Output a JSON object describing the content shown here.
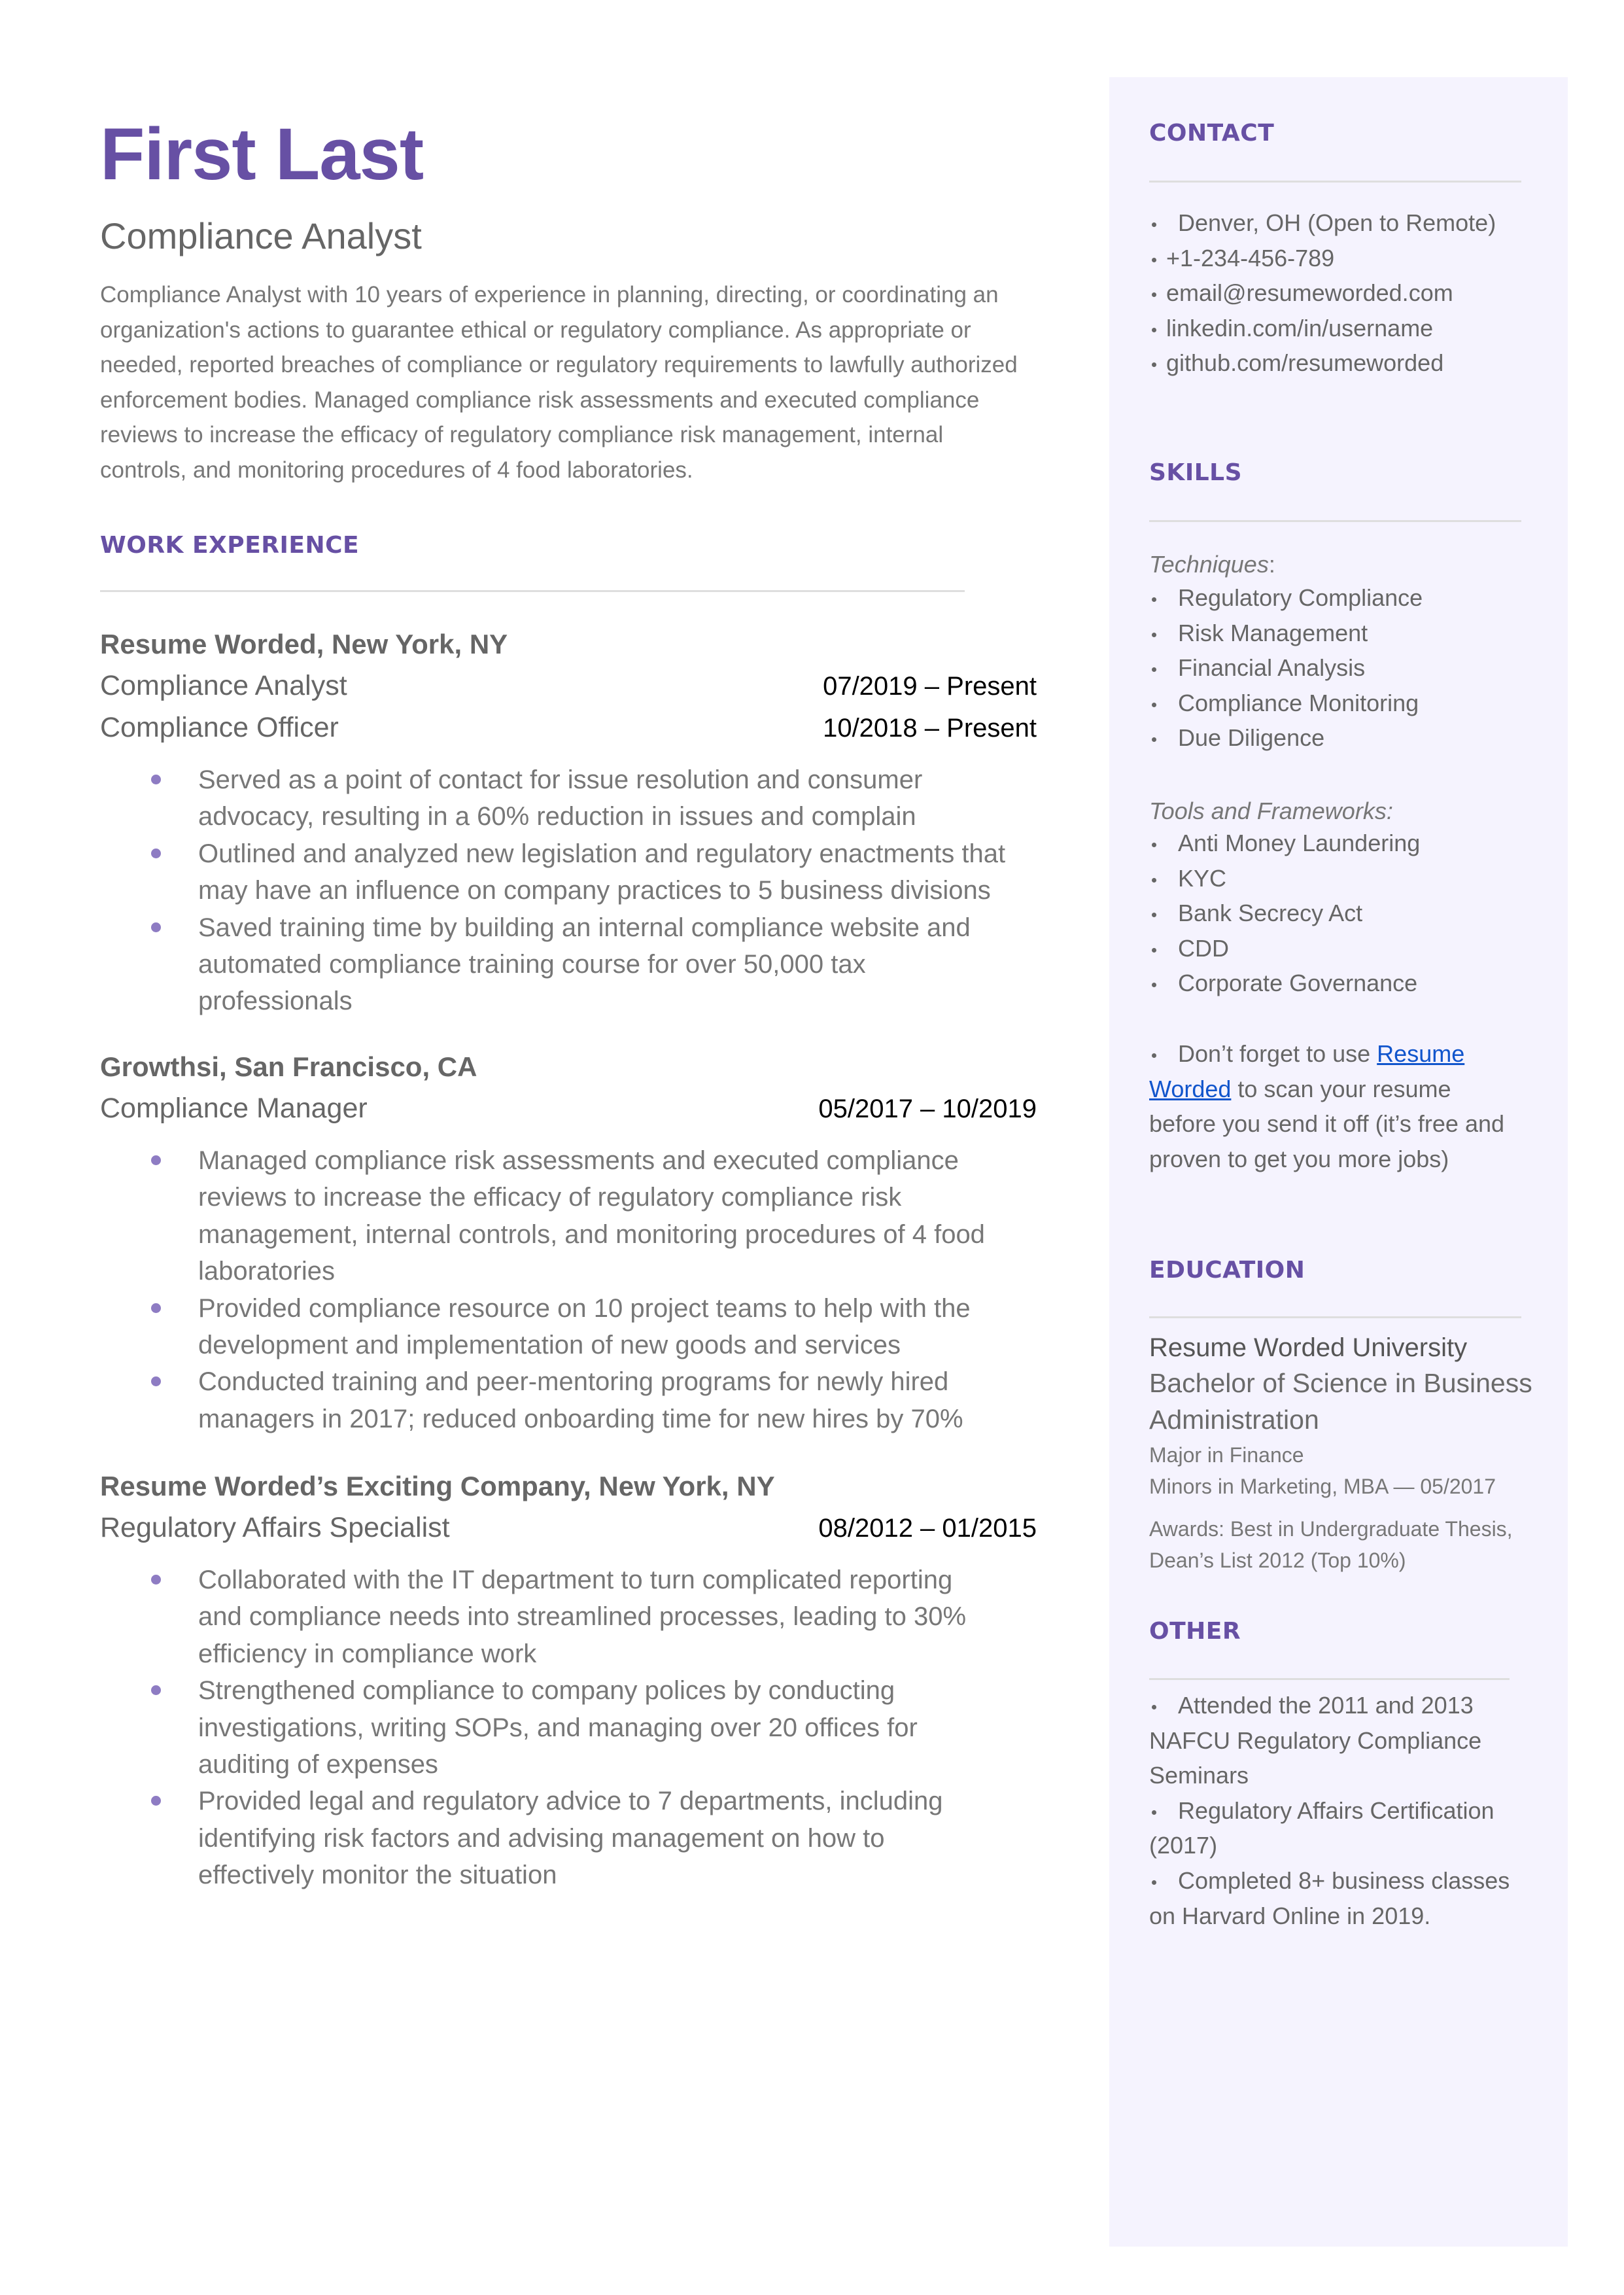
{
  "header": {
    "name": "First Last",
    "title": "Compliance Analyst",
    "summary_lines": [
      "Compliance Analyst with 10 years of experience in planning, directing, or coordinating an",
      "organization's actions to guarantee ethical or regulatory compliance. As appropriate or",
      "needed, reported breaches of compliance or regulatory requirements to lawfully authorized",
      "enforcement bodies. Managed compliance risk assessments and executed compliance",
      "reviews to increase the efficacy of regulatory compliance risk management, internal",
      "controls, and monitoring procedures of 4 food laboratories."
    ]
  },
  "work_experience": {
    "heading": "WORK EXPERIENCE",
    "jobs": [
      {
        "company": "Resume Worded, New York, NY",
        "roles": [
          {
            "title": "Compliance Analyst",
            "dates": "07/2019 – Present"
          },
          {
            "title": "Compliance Officer",
            "dates": "10/2018 – Present"
          }
        ],
        "bullets": [
          [
            "Served as a point of contact for issue resolution and consumer",
            "advocacy, resulting in a 60% reduction in issues and complain"
          ],
          [
            "Outlined and analyzed new legislation and regulatory enactments that",
            "may have an influence on company practices to 5 business divisions"
          ],
          [
            "Saved training time by building an internal compliance website and",
            "automated compliance training course for over 50,000 tax",
            "professionals"
          ]
        ]
      },
      {
        "company": "Growthsi, San Francisco, CA",
        "roles": [
          {
            "title": "Compliance Manager",
            "dates": "05/2017 – 10/2019"
          }
        ],
        "bullets": [
          [
            "Managed compliance risk assessments and executed compliance",
            "reviews to increase the efficacy of regulatory compliance risk",
            "management, internal controls, and monitoring procedures of 4 food",
            "laboratories"
          ],
          [
            "Provided compliance resource on 10 project teams to help with the",
            "development and implementation of new goods and services"
          ],
          [
            "Conducted training and peer-mentoring programs for newly hired",
            "managers in 2017; reduced onboarding time for new hires by 70%"
          ]
        ]
      },
      {
        "company": "Resume Worded’s Exciting Company, New York, NY",
        "roles": [
          {
            "title": "Regulatory Affairs Specialist",
            "dates": "08/2012 – 01/2015"
          }
        ],
        "bullets": [
          [
            "Collaborated with the IT department to turn complicated reporting",
            "and compliance needs into streamlined processes, leading to 30%",
            "efficiency in compliance work"
          ],
          [
            "Strengthened compliance to company polices by conducting",
            "investigations, writing SOPs, and managing over 20 offices for",
            "auditing of expenses"
          ],
          [
            "Provided legal and regulatory advice to 7 departments, including",
            "identifying risk factors and advising management on how to",
            "effectively monitor the situation"
          ]
        ]
      }
    ]
  },
  "sidebar": {
    "contact": {
      "heading": "CONTACT",
      "items": [
        "Denver, OH (Open to Remote)",
        "+1-234-456-789",
        "email@resumeworded.com",
        "linkedin.com/in/username",
        "github.com/resumeworded"
      ]
    },
    "skills": {
      "heading": "SKILLS",
      "techniques_label": "Techniques",
      "techniques_colon": ":",
      "techniques": [
        "Regulatory Compliance",
        "Risk Management",
        "Financial Analysis",
        "Compliance Monitoring",
        "Due Diligence"
      ],
      "tools_label": "Tools and Frameworks:",
      "tools": [
        "Anti Money Laundering",
        "KYC",
        "Bank Secrecy Act",
        "CDD",
        "Corporate Governance"
      ],
      "tip": {
        "prefix": "Don’t forget to use ",
        "link_line1": "Resume",
        "link_line2": "Worded",
        "suffix_line2": " to scan your resume",
        "line3": "before you send it off (it’s free and",
        "line4": "proven to get you more jobs)"
      }
    },
    "education": {
      "heading": "EDUCATION",
      "school": "Resume Worded University",
      "degree_line1": "Bachelor of Science in Business",
      "degree_line2": "Administration",
      "major": "Major in Finance",
      "minors": "Minors in Marketing, MBA — 05/2017",
      "awards_line1": "Awards: Best in Undergraduate Thesis,",
      "awards_line2": "Dean’s List 2012 (Top 10%)"
    },
    "other": {
      "heading": "OTHER",
      "items": [
        [
          "Attended the 2011 and 2013",
          "NAFCU Regulatory Compliance",
          "Seminars"
        ],
        [
          "Regulatory Affairs Certification",
          "(2017)"
        ],
        [
          "Completed 8+ business classes",
          "on Harvard Online in 2019."
        ]
      ]
    }
  },
  "colors": {
    "accent": "#6750a4",
    "bullet": "#8e7cc3",
    "sidebar_bg": "#f5f3fe",
    "link": "#1155cc",
    "text": "#666666"
  }
}
